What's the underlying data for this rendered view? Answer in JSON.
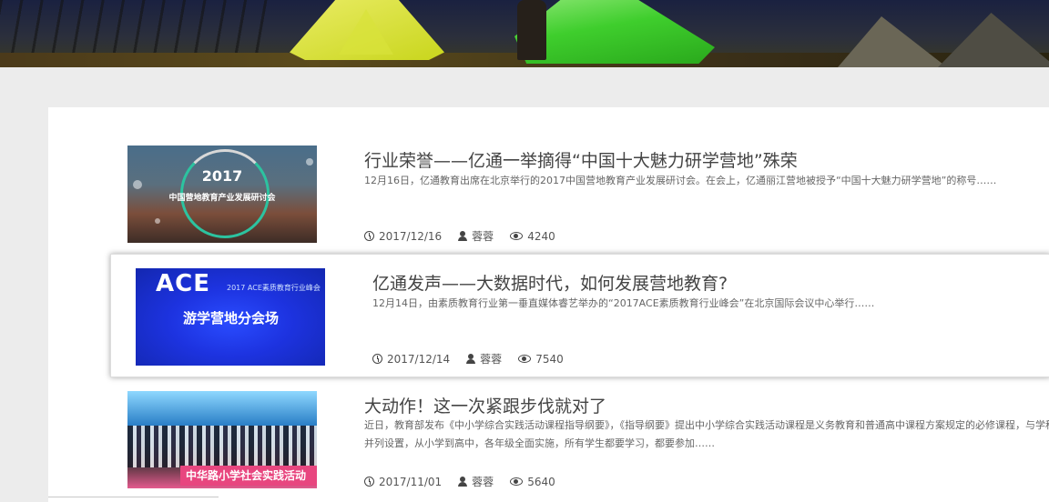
{
  "articles": [
    {
      "title": "行业荣誉——亿通一举摘得“中国十大魅力研学营地”殊荣",
      "summary": [
        "12月16日，亿通教育出席在北京举行的2017中国营地教育产业发展研讨会。在会上，亿通丽江营地被授予“中国十大魅力研学营地”的称号……"
      ],
      "date": "2017/12/16",
      "author": "蓉蓉",
      "views": "4240",
      "thumb": {
        "year": "2017",
        "caption": "中国营地教育产业发展研讨会"
      }
    },
    {
      "title": "亿通发声——大数据时代，如何发展营地教育?",
      "summary": [
        "12月14日，由素质教育行业第一垂直媒体睿艺举办的“2017ACE素质教育行业峰会”在北京国际会议中心举行……"
      ],
      "date": "2017/12/14",
      "author": "蓉蓉",
      "views": "7540",
      "thumb": {
        "logo": "ACE",
        "logo_sub": "2017 ACE素质教育行业峰会",
        "caption": "游学营地分会场"
      }
    },
    {
      "title": "大动作！这一次紧跟步伐就对了",
      "summary": [
        "近日，教育部发布《中小学综合实践活动课程指导纲要》，《指导纲要》提出中小学综合实践活动课程是义务教育和普通高中课程方案规定的必修课程，与学科",
        "并列设置，从小学到高中，各年级全面实施，所有学生都要学习，都要参加……"
      ],
      "date": "2017/11/01",
      "author": "蓉蓉",
      "views": "5640",
      "thumb": {
        "banner": "中华路小学社会实践活动"
      }
    }
  ]
}
